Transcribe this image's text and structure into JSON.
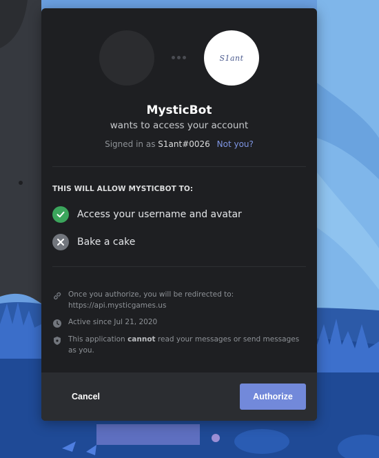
{
  "colors": {
    "modal_bg": "#1e1f22",
    "footer_bg": "#2b2d31",
    "accent": "#7289da",
    "link": "#7f96e5",
    "allow_green": "#3ba55c",
    "deny_gray": "#72767d"
  },
  "header": {
    "bot_avatar_signature": "S1ant",
    "app_name": "MysticBot",
    "subtitle": "wants to access your account",
    "signed_in_prefix": "Signed in as",
    "username": "S1ant#0026",
    "not_you": "Not you?"
  },
  "permissions": {
    "heading": "THIS WILL ALLOW MYSTICBOT TO:",
    "items": [
      {
        "label": "Access your username and avatar",
        "status": "allowed",
        "icon": "check-icon"
      },
      {
        "label": "Bake a cake",
        "status": "denied",
        "icon": "x-icon"
      }
    ]
  },
  "info": [
    {
      "icon": "link-icon",
      "text": "Once you authorize, you will be redirected to: https://api.mysticgames.us"
    },
    {
      "icon": "clock-icon",
      "text": "Active since Jul 21, 2020"
    },
    {
      "icon": "shield-icon",
      "text_before": "This application",
      "text_bold": "cannot",
      "text_after": "read your messages or send messages as you."
    }
  ],
  "footer": {
    "cancel_label": "Cancel",
    "authorize_label": "Authorize"
  }
}
